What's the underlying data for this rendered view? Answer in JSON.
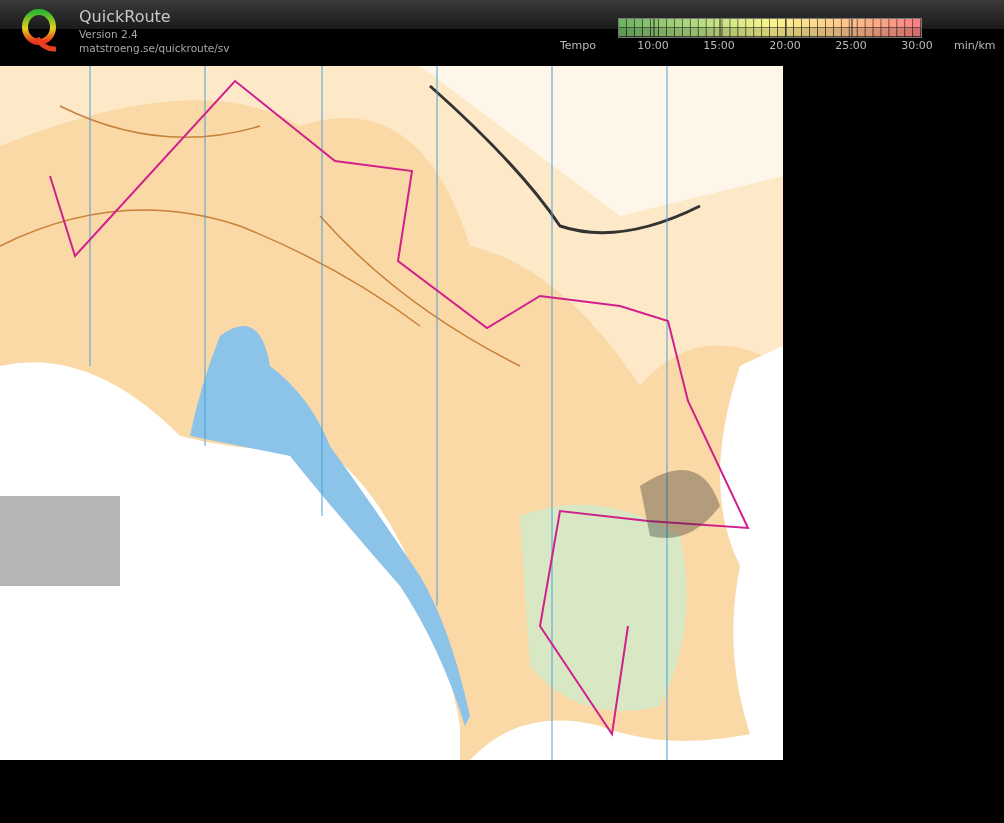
{
  "app": {
    "title": "QuickRoute",
    "version": "Version 2.4",
    "url": "matstroeng.se/quickroute/sv"
  },
  "legend": {
    "label": "Tempo",
    "ticks": [
      "10:00",
      "15:00",
      "20:00",
      "25:00",
      "30:00"
    ],
    "unit": "min/km"
  }
}
